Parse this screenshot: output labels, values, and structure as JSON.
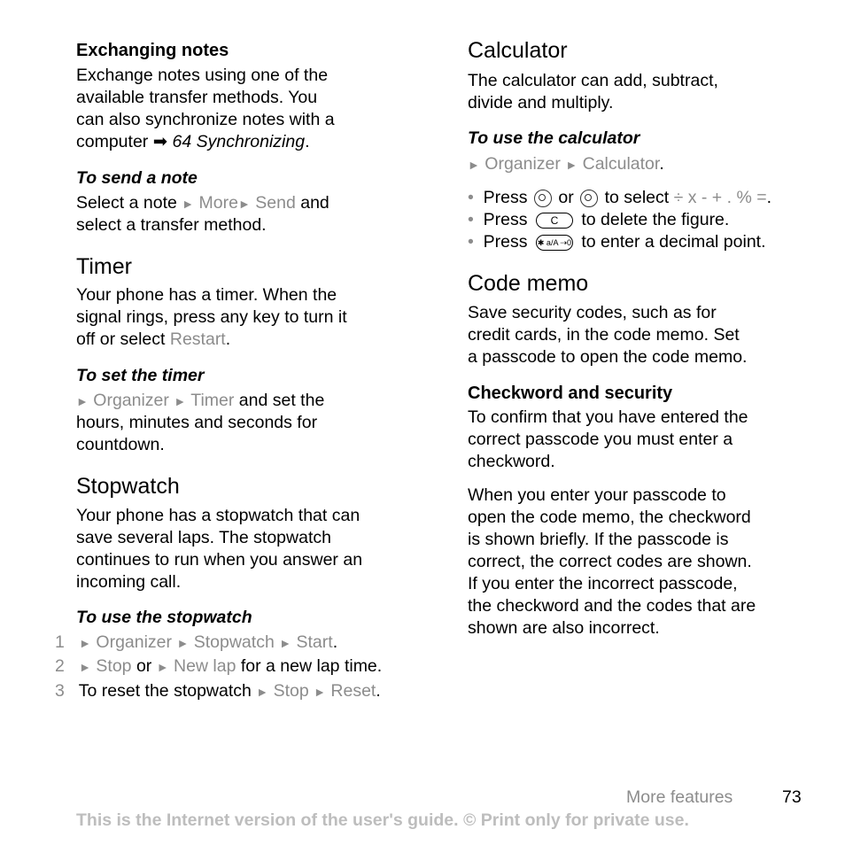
{
  "left": {
    "exchanging": {
      "title": "Exchanging notes",
      "lines": [
        "Exchange notes using one of the",
        "available transfer methods. You",
        "can also synchronize notes with a"
      ],
      "line4_pre": "computer",
      "line4_ref": "64 Synchronizing",
      "line4_post": "."
    },
    "send": {
      "title": "To send a note",
      "pre": "Select a note",
      "m1": "More",
      "m2": "Send",
      "post": "and",
      "line2": "select a transfer method."
    },
    "timer": {
      "title": "Timer",
      "lines": [
        "Your phone has a timer. When the",
        "signal rings, press any key to turn it"
      ],
      "line3_pre": "off or select",
      "line3_menu": "Restart",
      "line3_post": ".",
      "howto_title": "To set the timer",
      "m1": "Organizer",
      "m2": "Timer",
      "howto_post": "and set the",
      "howto_lines": [
        "hours, minutes and seconds for",
        "countdown."
      ]
    },
    "stopwatch": {
      "title": "Stopwatch",
      "lines": [
        "Your phone has a stopwatch that can",
        "save several laps. The stopwatch",
        "continues to run when you answer an",
        "incoming call."
      ],
      "howto_title": "To use the stopwatch",
      "steps": [
        {
          "num": "1",
          "m1": "Organizer",
          "m2": "Stopwatch",
          "m3": "Start",
          "post": "."
        },
        {
          "num": "2",
          "m1": "Stop",
          "mid": "or",
          "m2": "New lap",
          "post": "for a new lap time."
        },
        {
          "num": "3",
          "pre": "To reset the stopwatch",
          "m1": "Stop",
          "m2": "Reset",
          "post": "."
        }
      ]
    }
  },
  "right": {
    "calculator": {
      "title": "Calculator",
      "lines": [
        "The calculator can add, subtract,",
        "divide and multiply."
      ],
      "howto_title": "To use the calculator",
      "m1": "Organizer",
      "m2": "Calculator",
      "m_post": ".",
      "bullets": [
        {
          "pre": "Press",
          "mid": "or",
          "post": "to select",
          "ops": "÷ x - + . % =",
          "end": "."
        },
        {
          "pre": "Press",
          "key": "C",
          "post": "to delete the figure."
        },
        {
          "pre": "Press",
          "key": "✱ a/A ⇢0",
          "post": "to enter a decimal point."
        }
      ]
    },
    "codememo": {
      "title": "Code memo",
      "lines": [
        "Save security codes, such as for",
        "credit cards, in the code memo. Set",
        "a passcode to open the code memo."
      ],
      "sub_title": "Checkword and security",
      "sub_lines": [
        "To confirm that you have entered the",
        "correct passcode you must enter a",
        "checkword."
      ],
      "para_lines": [
        "When you enter your passcode to",
        "open the code memo, the checkword",
        "is shown briefly. If the passcode is",
        "correct, the correct codes are shown.",
        "If you enter the incorrect passcode,",
        "the checkword and the codes that are",
        "shown are also incorrect."
      ]
    }
  },
  "footer": {
    "section": "More features",
    "page": "73",
    "disclaimer": "This is the Internet version of the user's guide. © Print only for private use."
  },
  "glyphs": {
    "arrow": "►",
    "ref_arrow": "➡"
  }
}
